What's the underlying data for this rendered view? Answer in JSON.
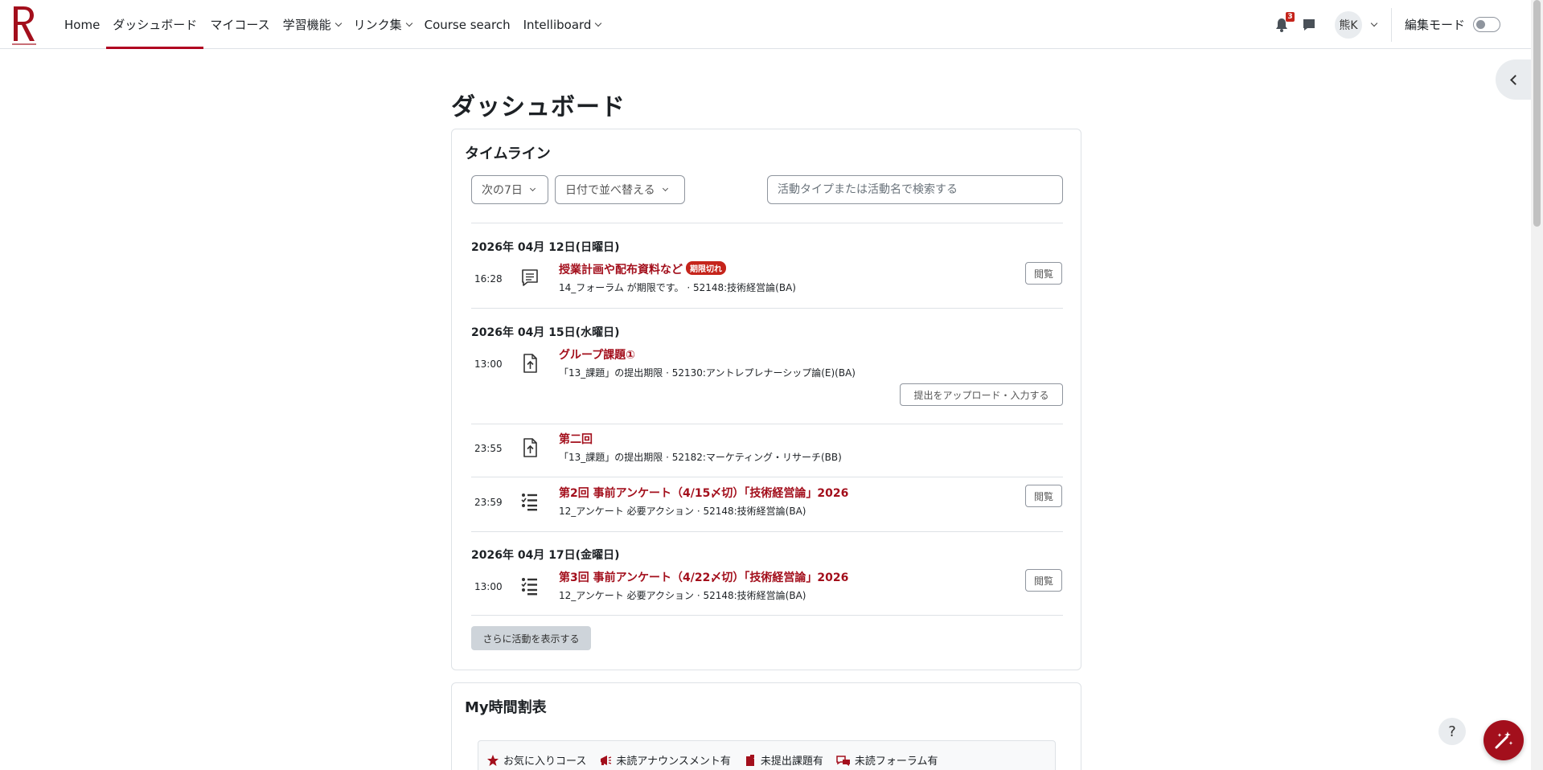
{
  "nav": {
    "items": [
      {
        "label": "Home",
        "dropdown": false,
        "active": false
      },
      {
        "label": "ダッシュボード",
        "dropdown": false,
        "active": true
      },
      {
        "label": "マイコース",
        "dropdown": false,
        "active": false
      },
      {
        "label": "学習機能",
        "dropdown": true,
        "active": false
      },
      {
        "label": "リンク集",
        "dropdown": true,
        "active": false
      },
      {
        "label": "Course search",
        "dropdown": false,
        "active": false
      },
      {
        "label": "Intelliboard",
        "dropdown": true,
        "active": false
      }
    ],
    "notification_count": "3",
    "user_initials": "熊K",
    "edit_mode_label": "編集モード",
    "edit_mode_on": false
  },
  "page": {
    "title": "ダッシュボード"
  },
  "timeline": {
    "title": "タイムライン",
    "range_label": "次の7日",
    "sort_label": "日付で並べ替える",
    "search_placeholder": "活動タイプまたは活動名で検索する",
    "dates": [
      "2026年 04月 12日(日曜日)",
      "2026年 04月 15日(水曜日)",
      "2026年 04月 17日(金曜日)"
    ],
    "events": [
      {
        "time": "16:28",
        "icon": "forum-icon",
        "title": "授業計画や配布資料など",
        "badge": "期限切れ",
        "sub": "14_フォーラム が期限です。 · 52148:技術経営論(BA)",
        "action": "閲覧"
      },
      {
        "time": "13:00",
        "icon": "assignment-upload-icon",
        "title": "グループ課題①",
        "sub": "「13_課題」の提出期限 · 52130:アントレプレナーシップ論(E)(BA)",
        "action": "提出をアップロード・入力する"
      },
      {
        "time": "23:55",
        "icon": "assignment-upload-icon",
        "title": "第二回",
        "sub": "「13_課題」の提出期限 · 52182:マーケティング・リサーチ(BB)",
        "action": ""
      },
      {
        "time": "23:59",
        "icon": "questionnaire-icon",
        "title": "第2回 事前アンケート（4/15〆切）「技術経営論」2026",
        "sub": "12_アンケート 必要アクション · 52148:技術経営論(BA)",
        "action": "閲覧"
      },
      {
        "time": "13:00",
        "icon": "questionnaire-icon",
        "title": "第3回 事前アンケート（4/22〆切）「技術経営論」2026",
        "sub": "12_アンケート 必要アクション · 52148:技術経営論(BA)",
        "action": "閲覧"
      }
    ],
    "more_label": "さらに活動を表示する"
  },
  "schedule": {
    "title": "My時間割表",
    "legend": [
      {
        "icon": "star-icon",
        "label": "お気に入りコース"
      },
      {
        "icon": "megaphone-icon",
        "label": "未読アナウンスメント有"
      },
      {
        "icon": "assignment-icon",
        "label": "未提出課題有"
      },
      {
        "icon": "forum-unread-icon",
        "label": "未読フォーラム有"
      }
    ]
  },
  "help": {
    "label": "?"
  },
  "colors": {
    "accent": "#a30f1c",
    "badge": "#c5241b",
    "border": "#dee2e6"
  }
}
